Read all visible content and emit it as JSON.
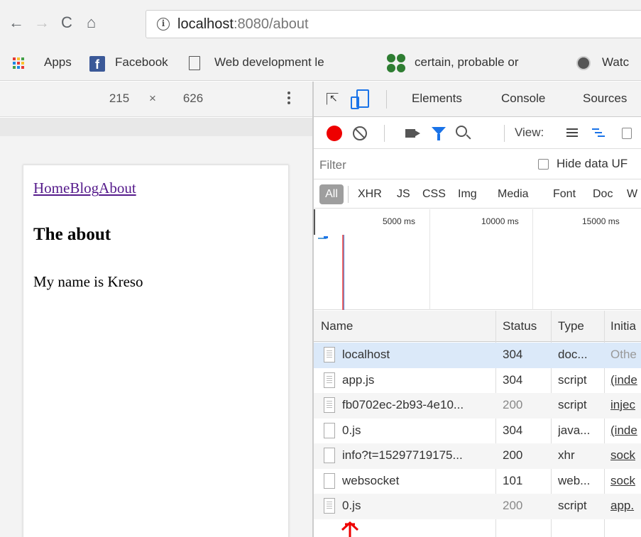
{
  "browser": {
    "url_host": "localhost",
    "url_path": ":8080/about",
    "bookmarks": [
      {
        "label": "Apps",
        "icon": "apps-grid-icon"
      },
      {
        "label": "Facebook",
        "icon": "facebook-icon"
      },
      {
        "label": "Web development le",
        "icon": "page-icon"
      },
      {
        "label": "certain, probable or ",
        "icon": "clover-icon"
      },
      {
        "label": "Watc",
        "icon": "film-reel-icon"
      }
    ]
  },
  "device_toolbar": {
    "width": "215",
    "times": "×",
    "height": "626"
  },
  "site": {
    "nav": [
      "Home",
      "Blog",
      "About"
    ],
    "heading": "The about",
    "paragraph": "My name is Kreso"
  },
  "devtools": {
    "tabs": [
      "Elements",
      "Console",
      "Sources"
    ],
    "view_label": "View:",
    "filter_placeholder": "Filter",
    "hide_data_label": "Hide data UF",
    "types": [
      "All",
      "XHR",
      "JS",
      "CSS",
      "Img",
      "Media",
      "Font",
      "Doc",
      "W"
    ],
    "timeline_ticks": [
      "5000 ms",
      "10000 ms",
      "15000 ms"
    ],
    "columns": [
      "Name",
      "Status",
      "Type",
      "Initia"
    ],
    "requests": [
      {
        "name": "localhost",
        "status": "304",
        "type": "doc...",
        "initiator": "Othe",
        "icon": "document-icon"
      },
      {
        "name": "app.js",
        "status": "304",
        "type": "script",
        "initiator": "(inde",
        "icon": "document-icon"
      },
      {
        "name": "fb0702ec-2b93-4e10...",
        "status": "200",
        "type": "script",
        "initiator": "injec",
        "icon": "document-icon"
      },
      {
        "name": "0.js",
        "status": "304",
        "type": "java...",
        "initiator": "(inde",
        "icon": "blank-file-icon"
      },
      {
        "name": "info?t=15297719175...",
        "status": "200",
        "type": "xhr",
        "initiator": "sock",
        "icon": "blank-file-icon"
      },
      {
        "name": "websocket",
        "status": "101",
        "type": "web...",
        "initiator": "sock",
        "icon": "blank-file-icon"
      },
      {
        "name": "0.js",
        "status": "200",
        "type": "script",
        "initiator": "app.",
        "icon": "document-icon"
      }
    ]
  },
  "colors": {
    "record": "#ee0000",
    "accent": "#1a73e8",
    "selected_row": "#dbe9f9",
    "link_visited": "#551a8b"
  }
}
